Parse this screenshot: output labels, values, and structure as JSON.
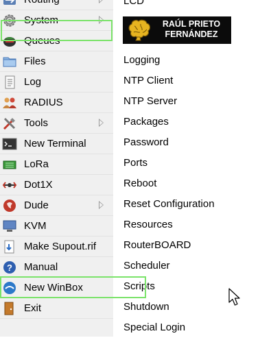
{
  "left_menu": {
    "items": [
      {
        "label": "Routing",
        "icon": "routing-icon",
        "submenu": true
      },
      {
        "label": "System",
        "icon": "gear-icon",
        "submenu": true
      },
      {
        "label": "Queues",
        "icon": "queues-icon",
        "submenu": false
      },
      {
        "label": "Files",
        "icon": "folder-icon",
        "submenu": false
      },
      {
        "label": "Log",
        "icon": "log-icon",
        "submenu": false
      },
      {
        "label": "RADIUS",
        "icon": "users-icon",
        "submenu": false
      },
      {
        "label": "Tools",
        "icon": "tools-icon",
        "submenu": true
      },
      {
        "label": "New Terminal",
        "icon": "terminal-icon",
        "submenu": false
      },
      {
        "label": "LoRa",
        "icon": "lora-icon",
        "submenu": false
      },
      {
        "label": "Dot1X",
        "icon": "dot1x-icon",
        "submenu": false
      },
      {
        "label": "Dude",
        "icon": "dude-icon",
        "submenu": true
      },
      {
        "label": "KVM",
        "icon": "kvm-icon",
        "submenu": false
      },
      {
        "label": "Make Supout.rif",
        "icon": "supout-icon",
        "submenu": false
      },
      {
        "label": "Manual",
        "icon": "help-icon",
        "submenu": false
      },
      {
        "label": "New WinBox",
        "icon": "winbox-icon",
        "submenu": false
      },
      {
        "label": "Exit",
        "icon": "exit-icon",
        "submenu": false
      }
    ],
    "highlighted": "System"
  },
  "submenu": {
    "top_partial": "LCD",
    "items": [
      {
        "label": "Logging"
      },
      {
        "label": "NTP Client"
      },
      {
        "label": "NTP Server"
      },
      {
        "label": "Packages"
      },
      {
        "label": "Password"
      },
      {
        "label": "Ports"
      },
      {
        "label": "Reboot"
      },
      {
        "label": "Reset Configuration"
      },
      {
        "label": "Resources"
      },
      {
        "label": "RouterBOARD"
      },
      {
        "label": "Scheduler"
      },
      {
        "label": "Scripts"
      },
      {
        "label": "Shutdown"
      },
      {
        "label": "Special Login"
      }
    ],
    "highlighted": "Scripts"
  },
  "watermark": {
    "line1": "RAÚL PRIETO",
    "line2": "FERNÁNDEZ"
  },
  "colors": {
    "highlight_border": "#7be36a",
    "menu_bg": "#f0f0f0",
    "submenu_bg": "#ffffff"
  }
}
